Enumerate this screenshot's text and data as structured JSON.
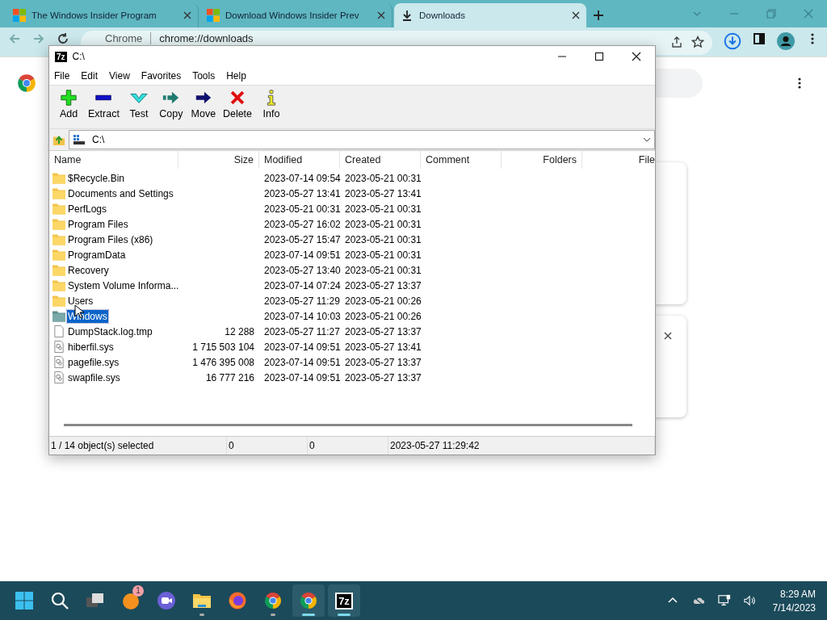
{
  "browser": {
    "tabs": [
      {
        "title": "The Windows Insider Program",
        "kind": "site",
        "selected": false
      },
      {
        "title": "Download Windows Insider Prev",
        "kind": "site",
        "selected": false
      },
      {
        "title": "Downloads",
        "kind": "downloads",
        "selected": true
      }
    ],
    "address": {
      "site": "Chrome",
      "url": "chrome://downloads"
    }
  },
  "window": {
    "logo": "7z",
    "title": "C:\\",
    "menu": [
      "File",
      "Edit",
      "View",
      "Favorites",
      "Tools",
      "Help"
    ],
    "toolbar": [
      {
        "label": "Add",
        "kind": "add"
      },
      {
        "label": "Extract",
        "kind": "extract"
      },
      {
        "label": "Test",
        "kind": "test"
      },
      {
        "label": "Copy",
        "kind": "copy"
      },
      {
        "label": "Move",
        "kind": "move"
      },
      {
        "label": "Delete",
        "kind": "delete"
      },
      {
        "label": "Info",
        "kind": "info"
      }
    ],
    "path": "C:\\",
    "columns": [
      "Name",
      "Size",
      "Modified",
      "Created",
      "Comment",
      "Folders",
      "File"
    ],
    "rows": [
      {
        "name": "$Recycle.Bin",
        "size": "",
        "modified": "2023-07-14 09:54",
        "created": "2023-05-21 00:31",
        "kind": "folder",
        "selected": false
      },
      {
        "name": "Documents and Settings",
        "size": "",
        "modified": "2023-05-27 13:41",
        "created": "2023-05-27 13:41",
        "kind": "folder",
        "selected": false
      },
      {
        "name": "PerfLogs",
        "size": "",
        "modified": "2023-05-21 00:31",
        "created": "2023-05-21 00:31",
        "kind": "folder",
        "selected": false
      },
      {
        "name": "Program Files",
        "size": "",
        "modified": "2023-05-27 16:02",
        "created": "2023-05-21 00:31",
        "kind": "folder",
        "selected": false
      },
      {
        "name": "Program Files (x86)",
        "size": "",
        "modified": "2023-05-27 15:47",
        "created": "2023-05-21 00:31",
        "kind": "folder",
        "selected": false
      },
      {
        "name": "ProgramData",
        "size": "",
        "modified": "2023-07-14 09:51",
        "created": "2023-05-21 00:31",
        "kind": "folder",
        "selected": false
      },
      {
        "name": "Recovery",
        "size": "",
        "modified": "2023-05-27 13:40",
        "created": "2023-05-21 00:31",
        "kind": "folder",
        "selected": false
      },
      {
        "name": "System Volume Informa...",
        "size": "",
        "modified": "2023-07-14 07:24",
        "created": "2023-05-27 13:37",
        "kind": "folder",
        "selected": false
      },
      {
        "name": "Users",
        "size": "",
        "modified": "2023-05-27 11:29",
        "created": "2023-05-21 00:26",
        "kind": "folder",
        "selected": false
      },
      {
        "name": "Windows",
        "size": "",
        "modified": "2023-07-14 10:03",
        "created": "2023-05-21 00:26",
        "kind": "folder",
        "selected": true
      },
      {
        "name": "DumpStack.log.tmp",
        "size": "12 288",
        "modified": "2023-05-27 11:27",
        "created": "2023-05-27 13:37",
        "kind": "file",
        "selected": false
      },
      {
        "name": "hiberfil.sys",
        "size": "1 715 503 104",
        "modified": "2023-07-14 09:51",
        "created": "2023-05-27 13:41",
        "kind": "system",
        "selected": false
      },
      {
        "name": "pagefile.sys",
        "size": "1 476 395 008",
        "modified": "2023-07-14 09:51",
        "created": "2023-05-27 13:37",
        "kind": "system",
        "selected": false
      },
      {
        "name": "swapfile.sys",
        "size": "16 777 216",
        "modified": "2023-07-14 09:51",
        "created": "2023-05-27 13:37",
        "kind": "system",
        "selected": false
      }
    ],
    "status": [
      "1 / 14 object(s) selected",
      "0",
      "0",
      "2023-05-27 11:29:42"
    ]
  },
  "taskbar": {
    "items": [
      {
        "kind": "start",
        "running": false,
        "selected": false
      },
      {
        "kind": "search",
        "running": false,
        "selected": false
      },
      {
        "kind": "taskview",
        "running": false,
        "selected": false
      },
      {
        "kind": "orb",
        "running": false,
        "selected": false,
        "badge": "1"
      },
      {
        "kind": "meet",
        "running": false,
        "selected": false
      },
      {
        "kind": "explorer",
        "running": true,
        "selected": false
      },
      {
        "kind": "firefox",
        "running": false,
        "selected": false
      },
      {
        "kind": "chrome",
        "running": true,
        "selected": false
      },
      {
        "kind": "chrome",
        "running": true,
        "selected": true
      },
      {
        "kind": "sevenzip",
        "running": true,
        "selected": true,
        "logo": "7z"
      }
    ],
    "time": "8:29 AM",
    "date": "7/14/2023"
  }
}
